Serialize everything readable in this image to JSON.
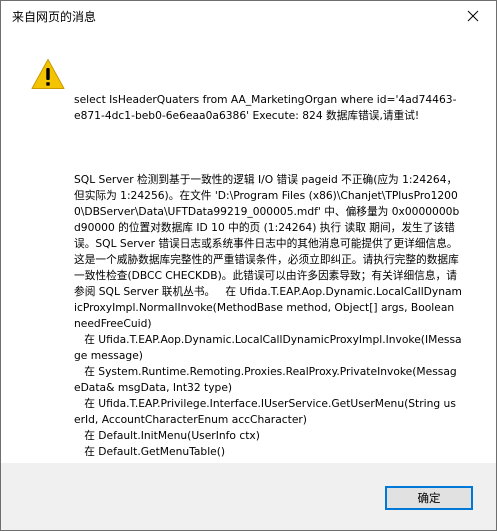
{
  "window": {
    "title": "来自网页的消息"
  },
  "icons": {
    "close": "close-icon",
    "warning": "warning-icon"
  },
  "colors": {
    "warning_fill": "#f5c400",
    "button_border": "#0078d7",
    "footer_bg": "#f0f0f0"
  },
  "message": {
    "paragraph1": "select IsHeaderQuaters from AA_MarketingOrgan where id='4ad74463-e871-4dc1-beb0-6e6eaa0a6386' Execute: 824 数据库错误,请重试!",
    "paragraph2": "SQL Server 检测到基于一致性的逻辑 I/O 错误 pageid 不正确(应为 1:24264，但实际为 1:24256)。在文件 'D:\\Program Files (x86)\\Chanjet\\TPlusPro12000\\DBServer\\Data\\UFTData99219_000005.mdf' 中、偏移量为 0x0000000bd90000 的位置对数据库 ID 10 中的页 (1:24264) 执行 读取 期间，发生了该错误。SQL Server 错误日志或系统事件日志中的其他消息可能提供了更详细信息。这是一个威胁数据库完整性的严重错误条件，必须立即纠正。请执行完整的数据库一致性检查(DBCC CHECKDB)。此错误可以由许多因素导致；有关详细信息，请参阅 SQL Server 联机丛书。   在 Ufida.T.EAP.Aop.Dynamic.LocalCallDynamicProxyImpl.NormalInvoke(MethodBase method, Object[] args, Boolean needFreeCuid)\n   在 Ufida.T.EAP.Aop.Dynamic.LocalCallDynamicProxyImpl.Invoke(IMessage message)\n   在 System.Runtime.Remoting.Proxies.RealProxy.PrivateInvoke(MessageData& msgData, Int32 type)\n   在 Ufida.T.EAP.Privilege.Interface.IUserService.GetUserMenu(String userId, AccountCharacterEnum accCharacter)\n   在 Default.InitMenu(UserInfo ctx)\n   在 Default.GetMenuTable()"
  },
  "buttons": {
    "ok_label": "确定"
  }
}
